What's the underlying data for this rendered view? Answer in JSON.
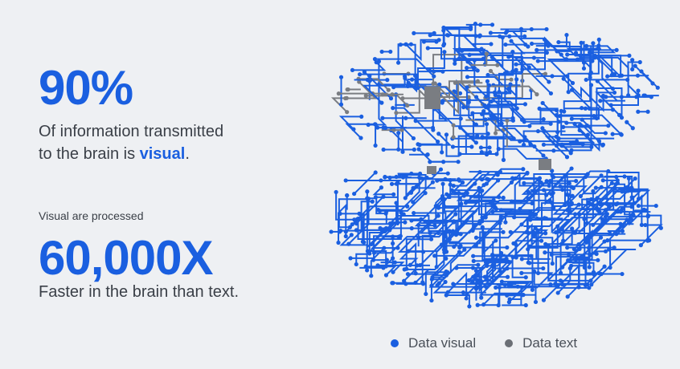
{
  "stat_visual": {
    "value": "90%",
    "line1": "Of information transmitted",
    "line2_prefix": "to the brain is ",
    "line2_highlight": "visual",
    "line2_suffix": "."
  },
  "stat_speed": {
    "pre_label": "Visual are processed",
    "value": "60,000X",
    "caption": "Faster in the brain than text."
  },
  "legend": {
    "items": [
      {
        "label": "Data visual",
        "color": "#1a5fe0"
      },
      {
        "label": "Data text",
        "color": "#6b6f75"
      }
    ]
  },
  "colors": {
    "accent": "#1a5fe0",
    "grey": "#7a7d82",
    "background": "#eef0f3"
  }
}
